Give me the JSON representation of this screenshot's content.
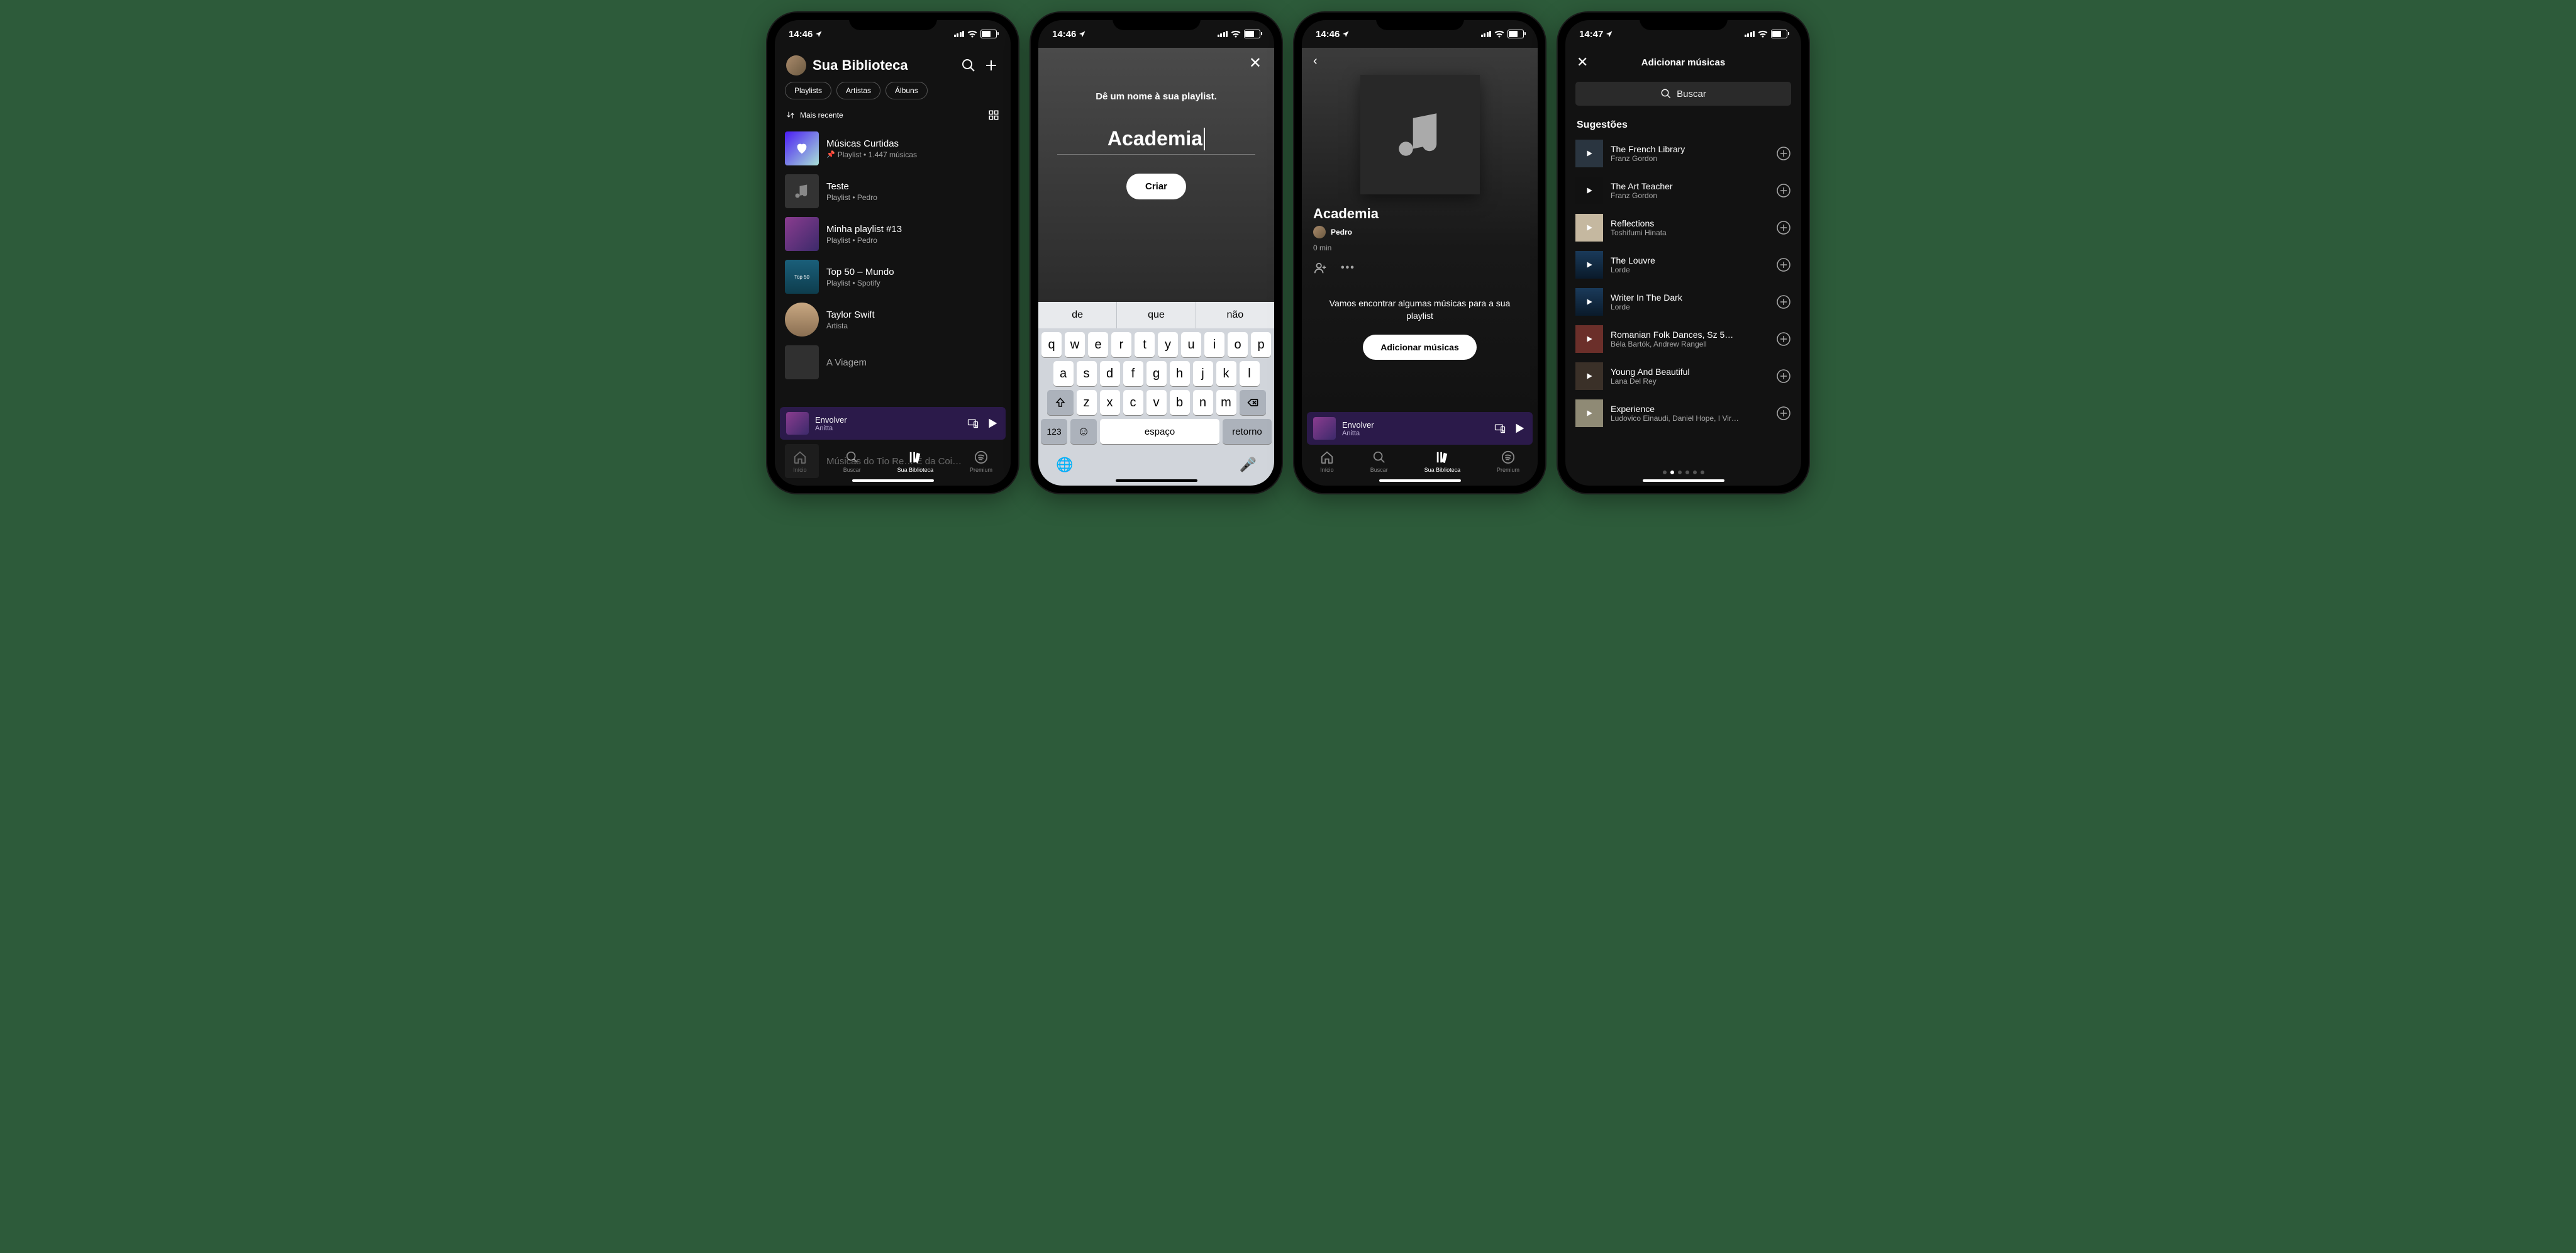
{
  "status": {
    "time1": "14:46",
    "time4": "14:47"
  },
  "screen1": {
    "title": "Sua Biblioteca",
    "chips": [
      "Playlists",
      "Artistas",
      "Álbuns"
    ],
    "sort": "Mais recente",
    "items": [
      {
        "title": "Músicas Curtidas",
        "sub": "Playlist • 1.447 músicas",
        "pinned": true,
        "style": "liked"
      },
      {
        "title": "Teste",
        "sub": "Playlist • Pedro",
        "style": "note"
      },
      {
        "title": "Minha playlist #13",
        "sub": "Playlist • Pedro",
        "style": "anitta"
      },
      {
        "title": "Top 50 – Mundo",
        "sub": "Playlist • Spotify",
        "style": "top50"
      },
      {
        "title": "Taylor Swift",
        "sub": "Artista",
        "style": "round"
      },
      {
        "title": "A Viagem",
        "sub": "",
        "style": ""
      },
      {
        "title": "Músicas do Tio Re…  É da Coi…",
        "sub": "",
        "style": "half"
      }
    ],
    "nowPlaying": {
      "title": "Envolver",
      "artist": "Anitta"
    },
    "tabs": [
      "Início",
      "Buscar",
      "Sua Biblioteca",
      "Premium"
    ]
  },
  "screen2": {
    "prompt": "Dê um nome à sua playlist.",
    "value": "Academia",
    "create": "Criar",
    "suggestions": [
      "de",
      "que",
      "não"
    ],
    "row1": [
      "q",
      "w",
      "e",
      "r",
      "t",
      "y",
      "u",
      "i",
      "o",
      "p"
    ],
    "row2": [
      "a",
      "s",
      "d",
      "f",
      "g",
      "h",
      "j",
      "k",
      "l"
    ],
    "row3": [
      "z",
      "x",
      "c",
      "v",
      "b",
      "n",
      "m"
    ],
    "space": "espaço",
    "return": "retorno",
    "num": "123"
  },
  "screen3": {
    "title": "Academia",
    "owner": "Pedro",
    "duration": "0 min",
    "empty": "Vamos encontrar algumas músicas para a sua playlist",
    "addBtn": "Adicionar músicas",
    "nowPlaying": {
      "title": "Envolver",
      "artist": "Anitta"
    },
    "tabs": [
      "Início",
      "Buscar",
      "Sua Biblioteca",
      "Premium"
    ]
  },
  "screen4": {
    "header": "Adicionar músicas",
    "searchPlaceholder": "Buscar",
    "section": "Sugestões",
    "songs": [
      {
        "title": "The French Library",
        "artist": "Franz Gordon"
      },
      {
        "title": "The Art Teacher",
        "artist": "Franz Gordon"
      },
      {
        "title": "Reflections",
        "artist": "Toshifumi Hinata"
      },
      {
        "title": "The Louvre",
        "artist": "Lorde"
      },
      {
        "title": "Writer In The Dark",
        "artist": "Lorde"
      },
      {
        "title": "Romanian Folk Dances, Sz 5…",
        "artist": "Béla Bartók, Andrew Rangell"
      },
      {
        "title": "Young And Beautiful",
        "artist": "Lana Del Rey"
      },
      {
        "title": "Experience",
        "artist": "Ludovico Einaudi, Daniel Hope, I Vir…"
      }
    ]
  }
}
